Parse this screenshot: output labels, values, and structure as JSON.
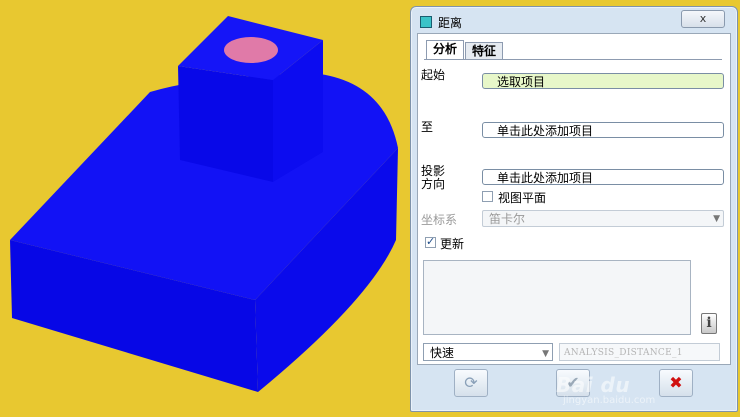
{
  "dialog": {
    "title": "距离",
    "close_label": "x",
    "tabs": [
      {
        "label": "分析"
      },
      {
        "label": "特征"
      }
    ],
    "from_label": "起始",
    "from_value": "选取项目",
    "to_label": "至",
    "to_value": "单击此处添加项目",
    "projection_label_line1": "投影",
    "projection_label_line2": "方向",
    "projection_value": "单击此处添加项目",
    "view_plane_label": "视图平面",
    "view_plane_checked": false,
    "coord_label": "坐标系",
    "coord_value": "笛卡尔",
    "update_label": "更新",
    "update_checked": true,
    "info_icon": "info-icon",
    "speed_value": "快速",
    "analysis_name": "ANALYSIS_DISTANCE_1"
  },
  "watermark": {
    "main": "Bai du",
    "sub": "jingyan.baidu.com"
  },
  "colors": {
    "background": "#e8c830",
    "model": "#0a0af0",
    "hole": "#e07aa8",
    "dialog": "#d6e4f2",
    "field_active": "#e7f7c9"
  }
}
